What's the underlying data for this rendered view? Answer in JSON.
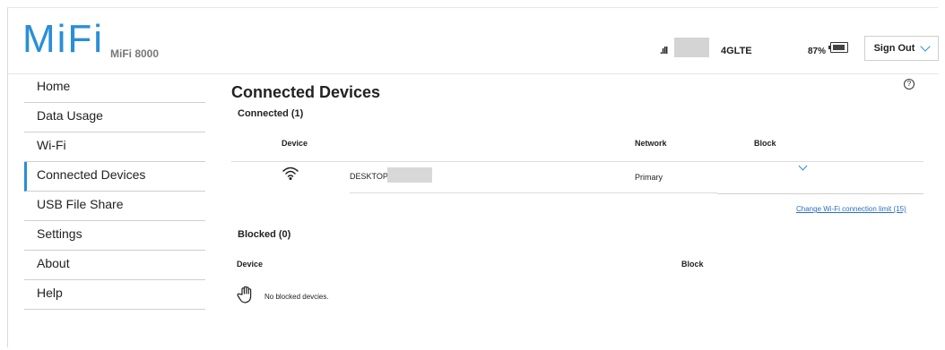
{
  "header": {
    "logo": "MiFi",
    "model": "MiFi 8000",
    "signal_glyph": ".ıll",
    "network_type": "4GLTE",
    "battery": "87%",
    "sign_out": "Sign Out"
  },
  "sidebar": {
    "items": [
      {
        "label": "Home"
      },
      {
        "label": "Data Usage"
      },
      {
        "label": "Wi-Fi"
      },
      {
        "label": "Connected Devices",
        "active": true
      },
      {
        "label": "USB File Share"
      },
      {
        "label": "Settings"
      },
      {
        "label": "About"
      },
      {
        "label": "Help"
      }
    ]
  },
  "main": {
    "title": "Connected Devices",
    "help": "?",
    "connected": {
      "label": "Connected (1)",
      "columns": {
        "device": "Device",
        "network": "Network",
        "block": "Block"
      },
      "rows": [
        {
          "icon": "wifi-icon",
          "device": "DESKTOP-",
          "network": "Primary"
        }
      ]
    },
    "change_link": "Change Wi-Fi connection limit (15)",
    "blocked": {
      "label": "Blocked (0)",
      "columns": {
        "device": "Device",
        "block": "Block"
      },
      "empty": "No blocked devcies."
    }
  },
  "colors": {
    "accent": "#2a8fd6",
    "link": "#2a6fc0"
  }
}
